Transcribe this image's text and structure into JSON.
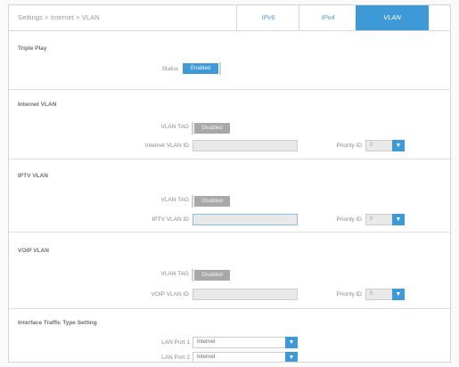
{
  "breadcrumb": "Settings > Internet > VLAN",
  "tabs": [
    {
      "label": "IPv6",
      "active": false
    },
    {
      "label": "IPv4",
      "active": false
    },
    {
      "label": "VLAN",
      "active": true
    }
  ],
  "triple_play": {
    "title": "Triple Play",
    "status_label": "Status",
    "status_value": "Enabled"
  },
  "internet_vlan": {
    "title": "Internet VLAN",
    "tag_label": "VLAN TAG",
    "tag_value": "Disabled",
    "id_label": "Internet VLAN ID",
    "id_value": "",
    "priority_label": "Priority ID",
    "priority_value": "0"
  },
  "iptv_vlan": {
    "title": "IPTV VLAN",
    "tag_label": "VLAN TAG",
    "tag_value": "Disabled",
    "id_label": "IPTV VLAN ID",
    "id_value": "",
    "priority_label": "Priority ID",
    "priority_value": "0"
  },
  "voip_vlan": {
    "title": "VOIP VLAN",
    "tag_label": "VLAN TAG",
    "tag_value": "Disabled",
    "id_label": "VOIP VLAN ID",
    "id_value": "",
    "priority_label": "Priority ID",
    "priority_value": "0"
  },
  "traffic": {
    "title": "Interface Traffic Type Setting",
    "ports": [
      {
        "label": "LAN Port 1",
        "value": "Internet"
      },
      {
        "label": "LAN Port 2",
        "value": "Internet"
      }
    ]
  },
  "icons": {
    "dropdown": "chevron-down-icon"
  },
  "colors": {
    "accent": "#3d9ad6",
    "disabled": "#a8a8a8"
  }
}
